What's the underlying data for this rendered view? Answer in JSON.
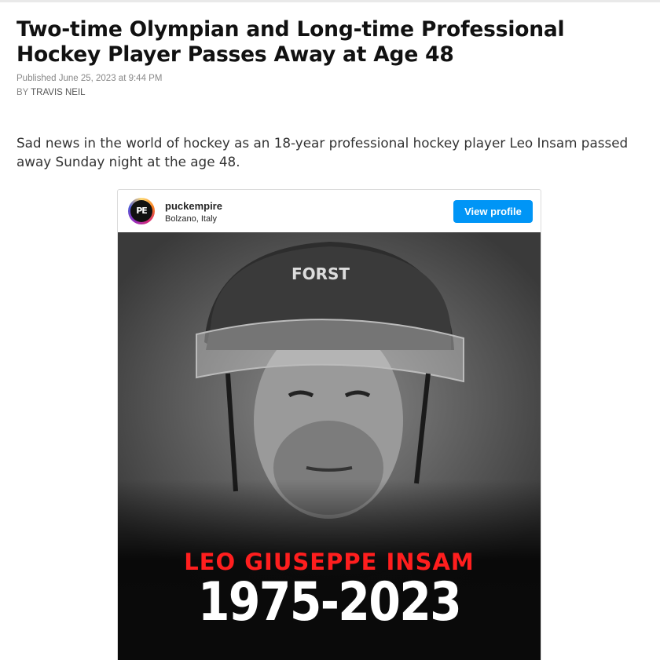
{
  "article": {
    "headline": "Two-time Olympian and Long-time Professional Hockey Player Passes Away at Age 48",
    "published": "Published June 25, 2023 at 9:44 PM",
    "by_prefix": "BY ",
    "author": "TRAVIS NEIL",
    "lead": "Sad news in the world of hockey as an 18-year professional hockey player Leo Insam passed away Sunday night at the age 48."
  },
  "embed": {
    "avatar_text": "PE",
    "username": "puckempire",
    "location": "Bolzano, Italy",
    "view_profile_label": "View profile",
    "helmet_brand": "FORST",
    "caption_name": "LEO GIUSEPPE INSAM",
    "caption_years": "1975-2023"
  },
  "colors": {
    "button": "#0095f6",
    "caption_name": "#ff1e1e"
  }
}
